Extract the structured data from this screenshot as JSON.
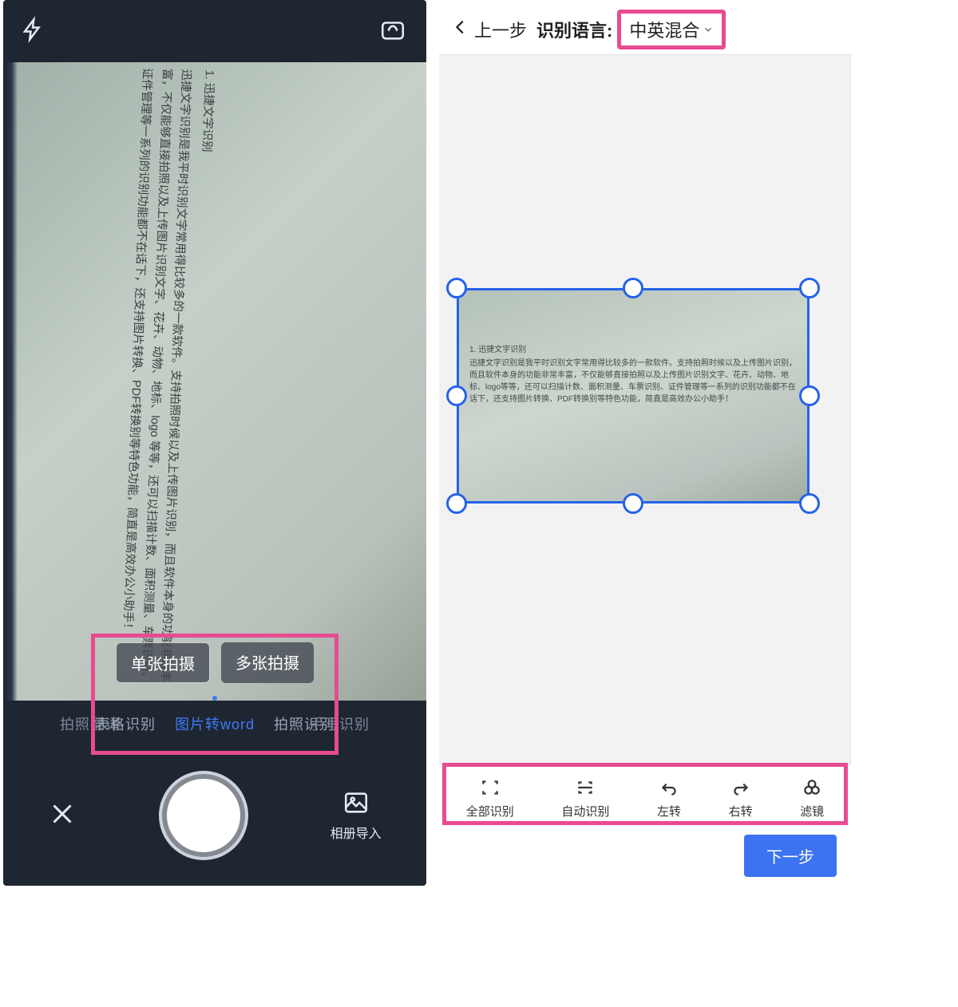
{
  "left": {
    "doc_title": "1. 迅捷文字识别",
    "doc_body": "迅捷文字识别是我平时识别文字常用得比较多的一款软件。支持拍照时候以及上传图片识别，而且软件本身的功能非常丰富，不仅能够直接拍照以及上传图片识别文字、花卉、动物、地标、logo 等等，还可以扫描计数、面积测量、车票识别、证件管理等一系列的识别功能都不在话下，还支持图片转换、PDF转换别等特色功能，简直是高效办公小助手！",
    "shot_toggle": {
      "single": "单张拍摄",
      "multi": "多张拍摄"
    },
    "modes": [
      "拍照翻译",
      "表格识别",
      "图片转word",
      "拍照识别",
      "手写识别"
    ],
    "import_label": "相册导入"
  },
  "right": {
    "back_label": "上一步",
    "lang_label": "识别语言:",
    "lang_value": "中英混合",
    "doc_title": "1. 迅捷文字识别",
    "doc_body": "迅捷文字识别是我平时识别文字常用得比较多的一款软件。支持拍照时候以及上传图片识别，而且软件本身的功能非常丰富，不仅能够直接拍照以及上传图片识别文字、花卉、动物、地标、logo等等，还可以扫描计数、面积测量、车票识别、证件管理等一系列的识别功能都不在话下，还支持图片转换、PDF转换别等特色功能，简直是高效办公小助手！",
    "tools": [
      "全部识别",
      "自动识别",
      "左转",
      "右转",
      "滤镜"
    ],
    "next": "下一步"
  }
}
